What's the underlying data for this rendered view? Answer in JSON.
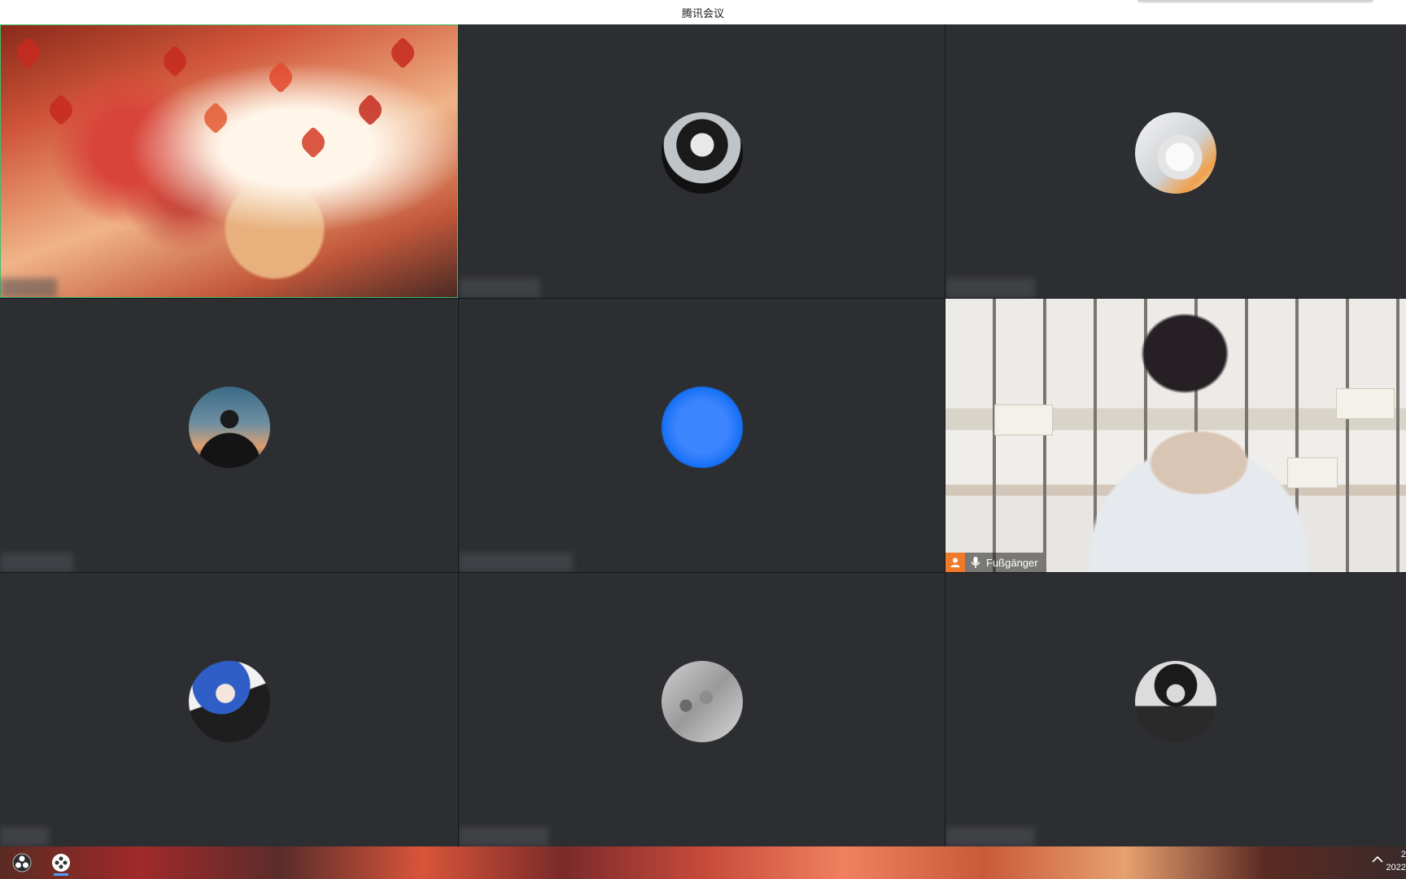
{
  "window": {
    "title": "腾讯会议"
  },
  "tiles": [
    {
      "type": "artwork",
      "avatar": "anime-wallpaper"
    },
    {
      "type": "avatar",
      "avatar": "anime-boy-scarf"
    },
    {
      "type": "avatar",
      "avatar": "white-puppy"
    },
    {
      "type": "avatar",
      "avatar": "silhouette-sunset"
    },
    {
      "type": "avatar",
      "avatar": "blue-circle"
    },
    {
      "type": "video",
      "name": "Fußgänger"
    },
    {
      "type": "avatar",
      "avatar": "anime-blue-hair"
    },
    {
      "type": "avatar",
      "avatar": "grey-sketch"
    },
    {
      "type": "avatar",
      "avatar": "anime-dark-suit"
    }
  ],
  "video_tile": {
    "participant_name": "Fußgänger",
    "role_icon": "host-icon",
    "mic_icon": "mic-icon"
  },
  "taskbar": {
    "clock_time": "2",
    "clock_date": "2022",
    "icons": [
      "obs-icon",
      "meeting-app-icon",
      "tray-up-icon"
    ]
  },
  "colors": {
    "tile_bg": "#2c2e32",
    "active_border": "#3fbf6a",
    "host_badge": "#f07a2a",
    "blue_avatar": "#1470f5"
  }
}
